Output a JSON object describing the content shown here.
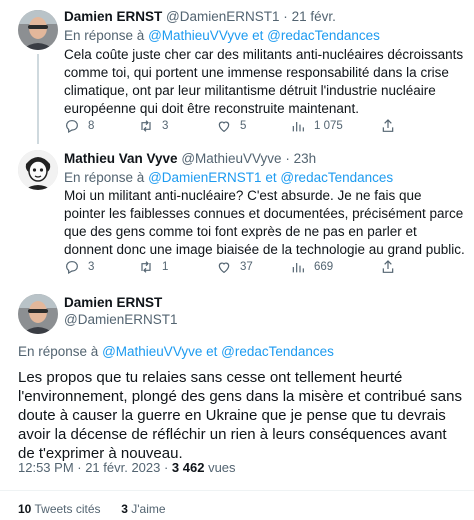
{
  "tweet1": {
    "name": "Damien ERNST",
    "handle": "@DamienERNST1",
    "sep": "·",
    "date": "21 févr.",
    "reply_prefix": "En réponse à",
    "reply_user1": "@MathieuVVyve",
    "reply_and": "et",
    "reply_user2": "@redacTendances",
    "text": "Cela coûte juste cher car des militants anti-nucléaires décroissants comme toi, qui portent une immense responsabilité dans la crise climatique, ont par leur militantisme détruit l'industrie nucléaire européenne qui doit être reconstruite maintenant.",
    "replies": "8",
    "retweets": "3",
    "likes": "5",
    "views": "1 075"
  },
  "tweet2": {
    "name": "Mathieu Van Vyve",
    "handle": "@MathieuVVyve",
    "sep": "·",
    "date": "23h",
    "reply_prefix": "En réponse à",
    "reply_user1": "@DamienERNST1",
    "reply_and": "et",
    "reply_user2": "@redacTendances",
    "text": "Moi un militant anti-nucléaire? C'est absurde. Je ne fais que pointer les faiblesses connues et documentées, précisément parce que des gens comme toi font exprès de ne pas en parler et donnent donc une image biaisée de la technologie au grand public.",
    "replies": "3",
    "retweets": "1",
    "likes": "37",
    "views": "669"
  },
  "tweet3": {
    "name": "Damien ERNST",
    "handle": "@DamienERNST1",
    "reply_prefix": "En réponse à",
    "reply_user1": "@MathieuVVyve",
    "reply_and": "et",
    "reply_user2": "@redacTendances",
    "text": "Les propos que tu relaies sans cesse ont tellement heurté l'environnement, plongé des gens dans la misère et contribué sans doute à causer la guerre en Ukraine que je pense que tu devrais avoir la décense de réfléchir un rien à leurs conséquences avant de t'exprimer à nouveau.",
    "timestamp": "12:53 PM · 21 févr. 2023 · ",
    "views_count": "3 462",
    "views_label": " vues",
    "quotes_count": "10",
    "quotes_label": "Tweets cités",
    "likes_count": "3",
    "likes_label": "J'aime"
  }
}
